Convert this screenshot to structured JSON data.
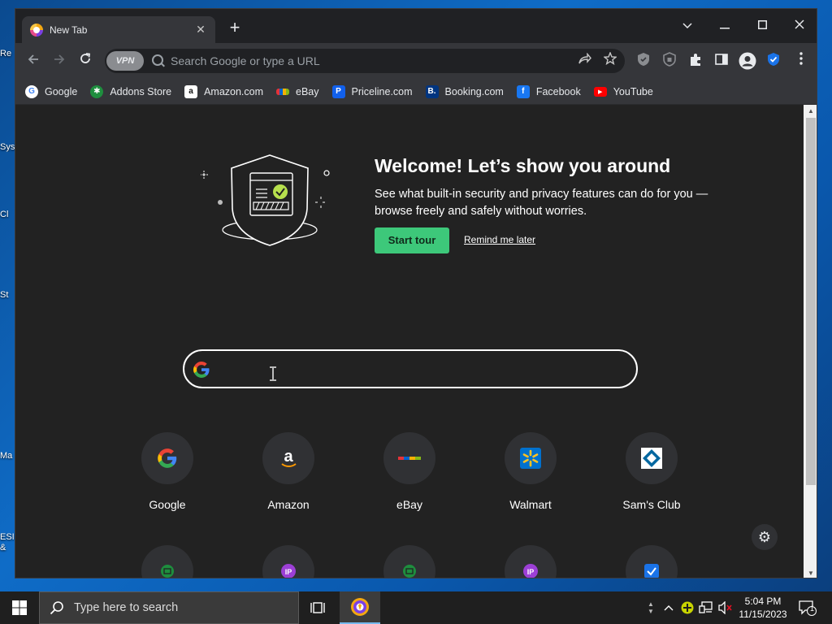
{
  "desktop": {
    "labels": [
      "Re",
      "Sys",
      "Cl",
      "St",
      "Ma",
      "ESI",
      "&"
    ]
  },
  "tab": {
    "title": "New Tab"
  },
  "omnibox": {
    "vpn_label": "VPN",
    "placeholder": "Search Google or type a URL"
  },
  "bookmarks": [
    {
      "label": "Google",
      "icon": "google-icon",
      "color": "#ffffff"
    },
    {
      "label": "Addons Store",
      "icon": "addons-store-icon",
      "color": "#1e8e3e"
    },
    {
      "label": "Amazon.com",
      "icon": "amazon-icon",
      "color": "#ffffff"
    },
    {
      "label": "eBay",
      "icon": "ebay-icon",
      "color": "#e53238"
    },
    {
      "label": "Priceline.com",
      "icon": "priceline-icon",
      "color": "#1160ec"
    },
    {
      "label": "Booking.com",
      "icon": "booking-icon",
      "color": "#003580"
    },
    {
      "label": "Facebook",
      "icon": "facebook-icon",
      "color": "#1877f2"
    },
    {
      "label": "YouTube",
      "icon": "youtube-icon",
      "color": "#ff0000"
    }
  ],
  "welcome": {
    "title": "Welcome! Let’s show you around",
    "description": "See what built-in security and privacy features can do for you — browse freely and safely without worries.",
    "start_tour": "Start tour",
    "remind_later": "Remind me later"
  },
  "shortcuts": [
    {
      "label": "Google"
    },
    {
      "label": "Amazon"
    },
    {
      "label": "eBay"
    },
    {
      "label": "Walmart"
    },
    {
      "label": "Sam's Club"
    }
  ],
  "taskbar": {
    "search_placeholder": "Type here to search",
    "time": "5:04 PM",
    "date": "11/15/2023",
    "notification_count": "1"
  },
  "colors": {
    "accent_green": "#3dc87a",
    "page_bg": "#222222",
    "toolbar_bg": "#35363a"
  }
}
